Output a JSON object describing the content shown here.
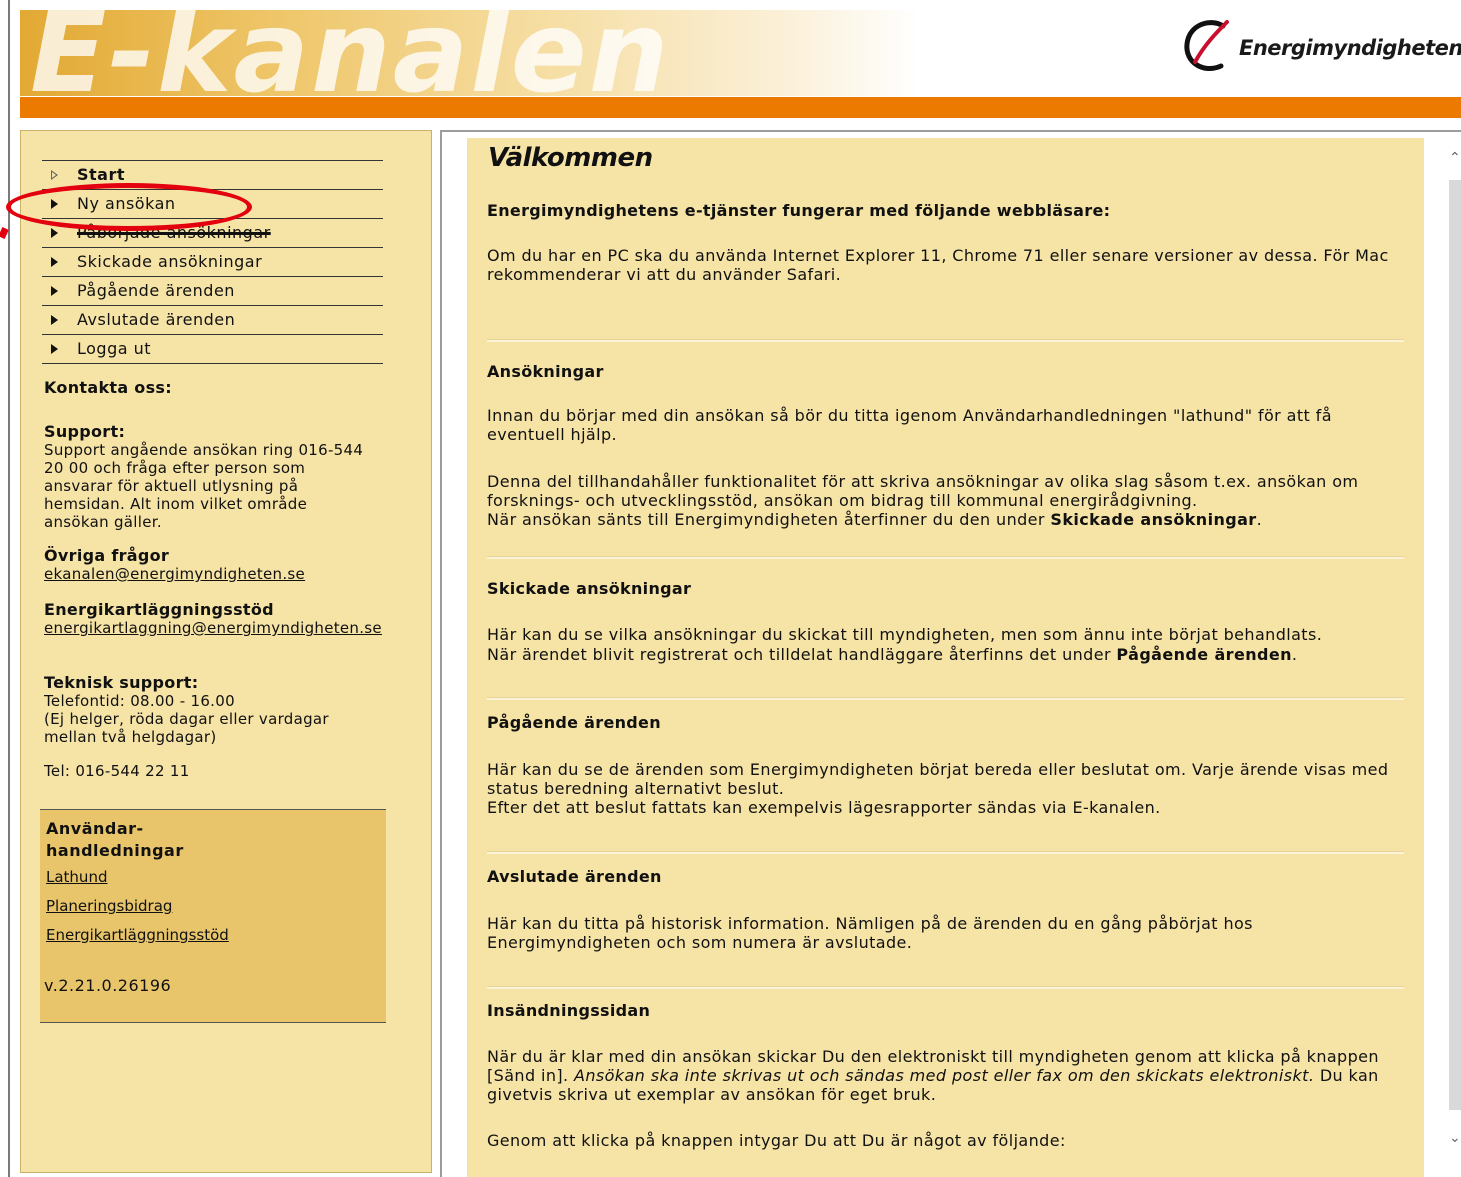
{
  "header": {
    "banner_title": "E-kanalen",
    "logo_text": "Energimyndigheten",
    "colors": {
      "orange_bar": "#ec7a00",
      "content_bg": "#f6e3a6",
      "guides_bg": "#e8c56a",
      "annotation": "#e3000f"
    }
  },
  "sidebar": {
    "nav": [
      {
        "label": "Start",
        "bold": true
      },
      {
        "label": "Ny ansökan"
      },
      {
        "label": "Påbörjade ansökningar"
      },
      {
        "label": "Skickade ansökningar"
      },
      {
        "label": "Pågående ärenden"
      },
      {
        "label": "Avslutade ärenden"
      },
      {
        "label": "Logga ut"
      }
    ],
    "contact_heading": "Kontakta oss:",
    "support": {
      "heading": "Support:",
      "text": "Support angående ansökan ring 016-544 20 00 och fråga efter person som ansvarar för aktuell utlysning på hemsidan. Alt inom vilket område ansökan gäller."
    },
    "other": {
      "heading": "Övriga frågor",
      "email": "ekanalen@energimyndigheten.se"
    },
    "energy_audit": {
      "heading": "Energikartläggningsstöd",
      "email": "energikartlaggning@energimyndigheten.se"
    },
    "tech": {
      "heading": "Teknisk support:",
      "hours": "Telefontid: 08.00 - 16.00",
      "note": "(Ej helger, röda dagar eller vardagar mellan två helgdagar)",
      "phone": "Tel: 016-544 22 11"
    },
    "guides": {
      "title_line1": "Användar-",
      "title_line2": "handledningar",
      "links": [
        "Lathund",
        "Planeringsbidrag",
        "Energikartläggningsstöd"
      ],
      "version": "v.2.21.0.26196"
    }
  },
  "main": {
    "title": "Välkommen",
    "browsers": {
      "heading": "Energimyndighetens e-tjänster fungerar med följande webbläsare:",
      "text": "Om du har en PC ska du använda Internet Explorer 11, Chrome 71 eller senare versioner av dessa. För Mac rekommenderar vi att du använder Safari."
    },
    "applications": {
      "heading": "Ansökningar",
      "p1": "Innan du börjar med din ansökan så bör du titta igenom Användarhandledningen \"lathund\" för att få eventuell hjälp.",
      "p2": "Denna del tillhandahåller funktionalitet för att skriva ansökningar av olika slag såsom t.ex. ansökan om forsknings- och utvecklingsstöd, ansökan om bidrag till kommunal energirådgivning.",
      "p3_pre": "När ansökan sänts till Energimyndigheten återfinner du den under ",
      "p3_bold": "Skickade ansökningar",
      "p3_post": "."
    },
    "sent": {
      "heading": "Skickade ansökningar",
      "p1": "Här kan du se vilka ansökningar du skickat till myndigheten, men som ännu inte börjat behandlats.",
      "p2_pre": "När ärendet blivit registrerat och tilldelat handläggare återfinns det under ",
      "p2_bold": "Pågående ärenden",
      "p2_post": "."
    },
    "ongoing": {
      "heading": "Pågående ärenden",
      "p1": "Här kan du se de ärenden som Energimyndigheten börjat bereda eller beslutat om. Varje ärende visas med status beredning alternativt beslut.",
      "p2": "Efter det att beslut fattats kan exempelvis lägesrapporter sändas via E-kanalen."
    },
    "closed": {
      "heading": "Avslutade ärenden",
      "p1": "Här kan du titta på historisk information. Nämligen på de ärenden du en gång påbörjat hos Energimyndigheten och som numera är avslutade."
    },
    "submission": {
      "heading": "Insändningssidan",
      "p1_pre": "När du är klar med din ansökan skickar Du den elektroniskt till myndigheten genom att klicka på knappen [Sänd in]. ",
      "p1_italic": "Ansökan ska inte skrivas ut och sändas med post eller fax om den skickats elektroniskt.",
      "p1_post": " Du kan givetvis skriva ut exemplar av ansökan för eget bruk.",
      "p2": "Genom att klicka på knappen intygar Du att Du är något av följande:"
    }
  }
}
